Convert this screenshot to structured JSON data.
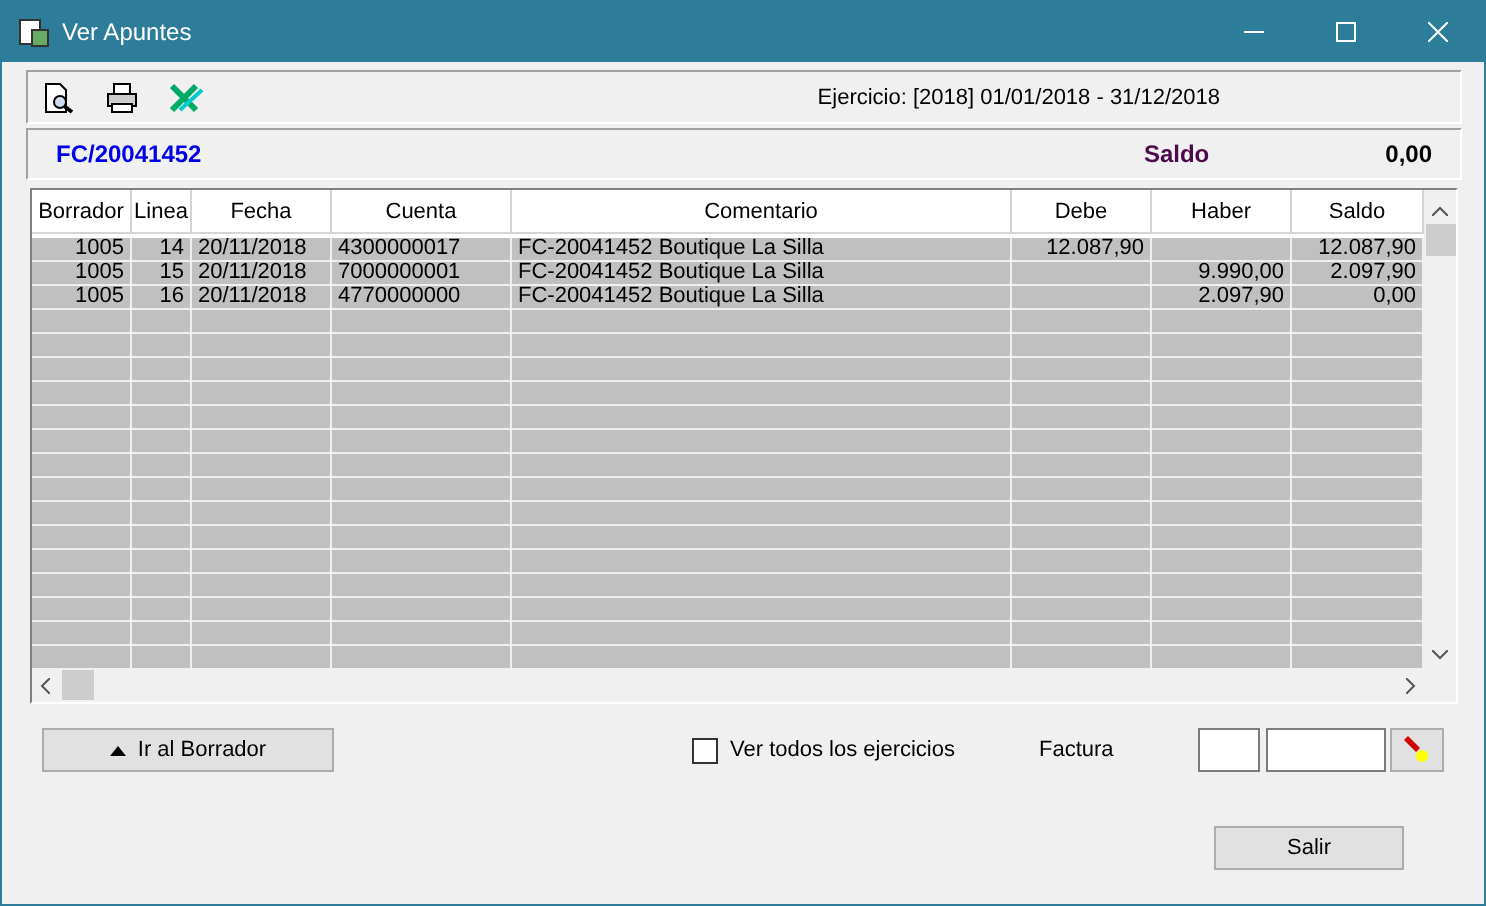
{
  "window": {
    "title": "Ver Apuntes"
  },
  "toolbar": {
    "ejercicio": "Ejercicio: [2018] 01/01/2018 - 31/12/2018"
  },
  "header": {
    "document": "FC/20041452",
    "saldo_label": "Saldo",
    "saldo_value": "0,00"
  },
  "table": {
    "columns": [
      "Borrador",
      "Linea",
      "Fecha",
      "Cuenta",
      "Comentario",
      "Debe",
      "Haber",
      "Saldo"
    ],
    "rows": [
      [
        "1005",
        "14",
        "20/11/2018",
        "4300000017",
        "FC-20041452 Boutique La Silla",
        "12.087,90",
        "",
        "12.087,90"
      ],
      [
        "1005",
        "15",
        "20/11/2018",
        "7000000001",
        "FC-20041452 Boutique La Silla",
        "",
        "9.990,00",
        "2.097,90"
      ],
      [
        "1005",
        "16",
        "20/11/2018",
        "4770000000",
        "FC-20041452 Boutique La Silla",
        "",
        "2.097,90",
        "0,00"
      ]
    ]
  },
  "footer": {
    "go_button": "Ir al Borrador",
    "all_years": {
      "label": "Ver todos los ejercicios",
      "checked": false
    },
    "factura_label": "Factura",
    "exit_button": "Salir"
  }
}
